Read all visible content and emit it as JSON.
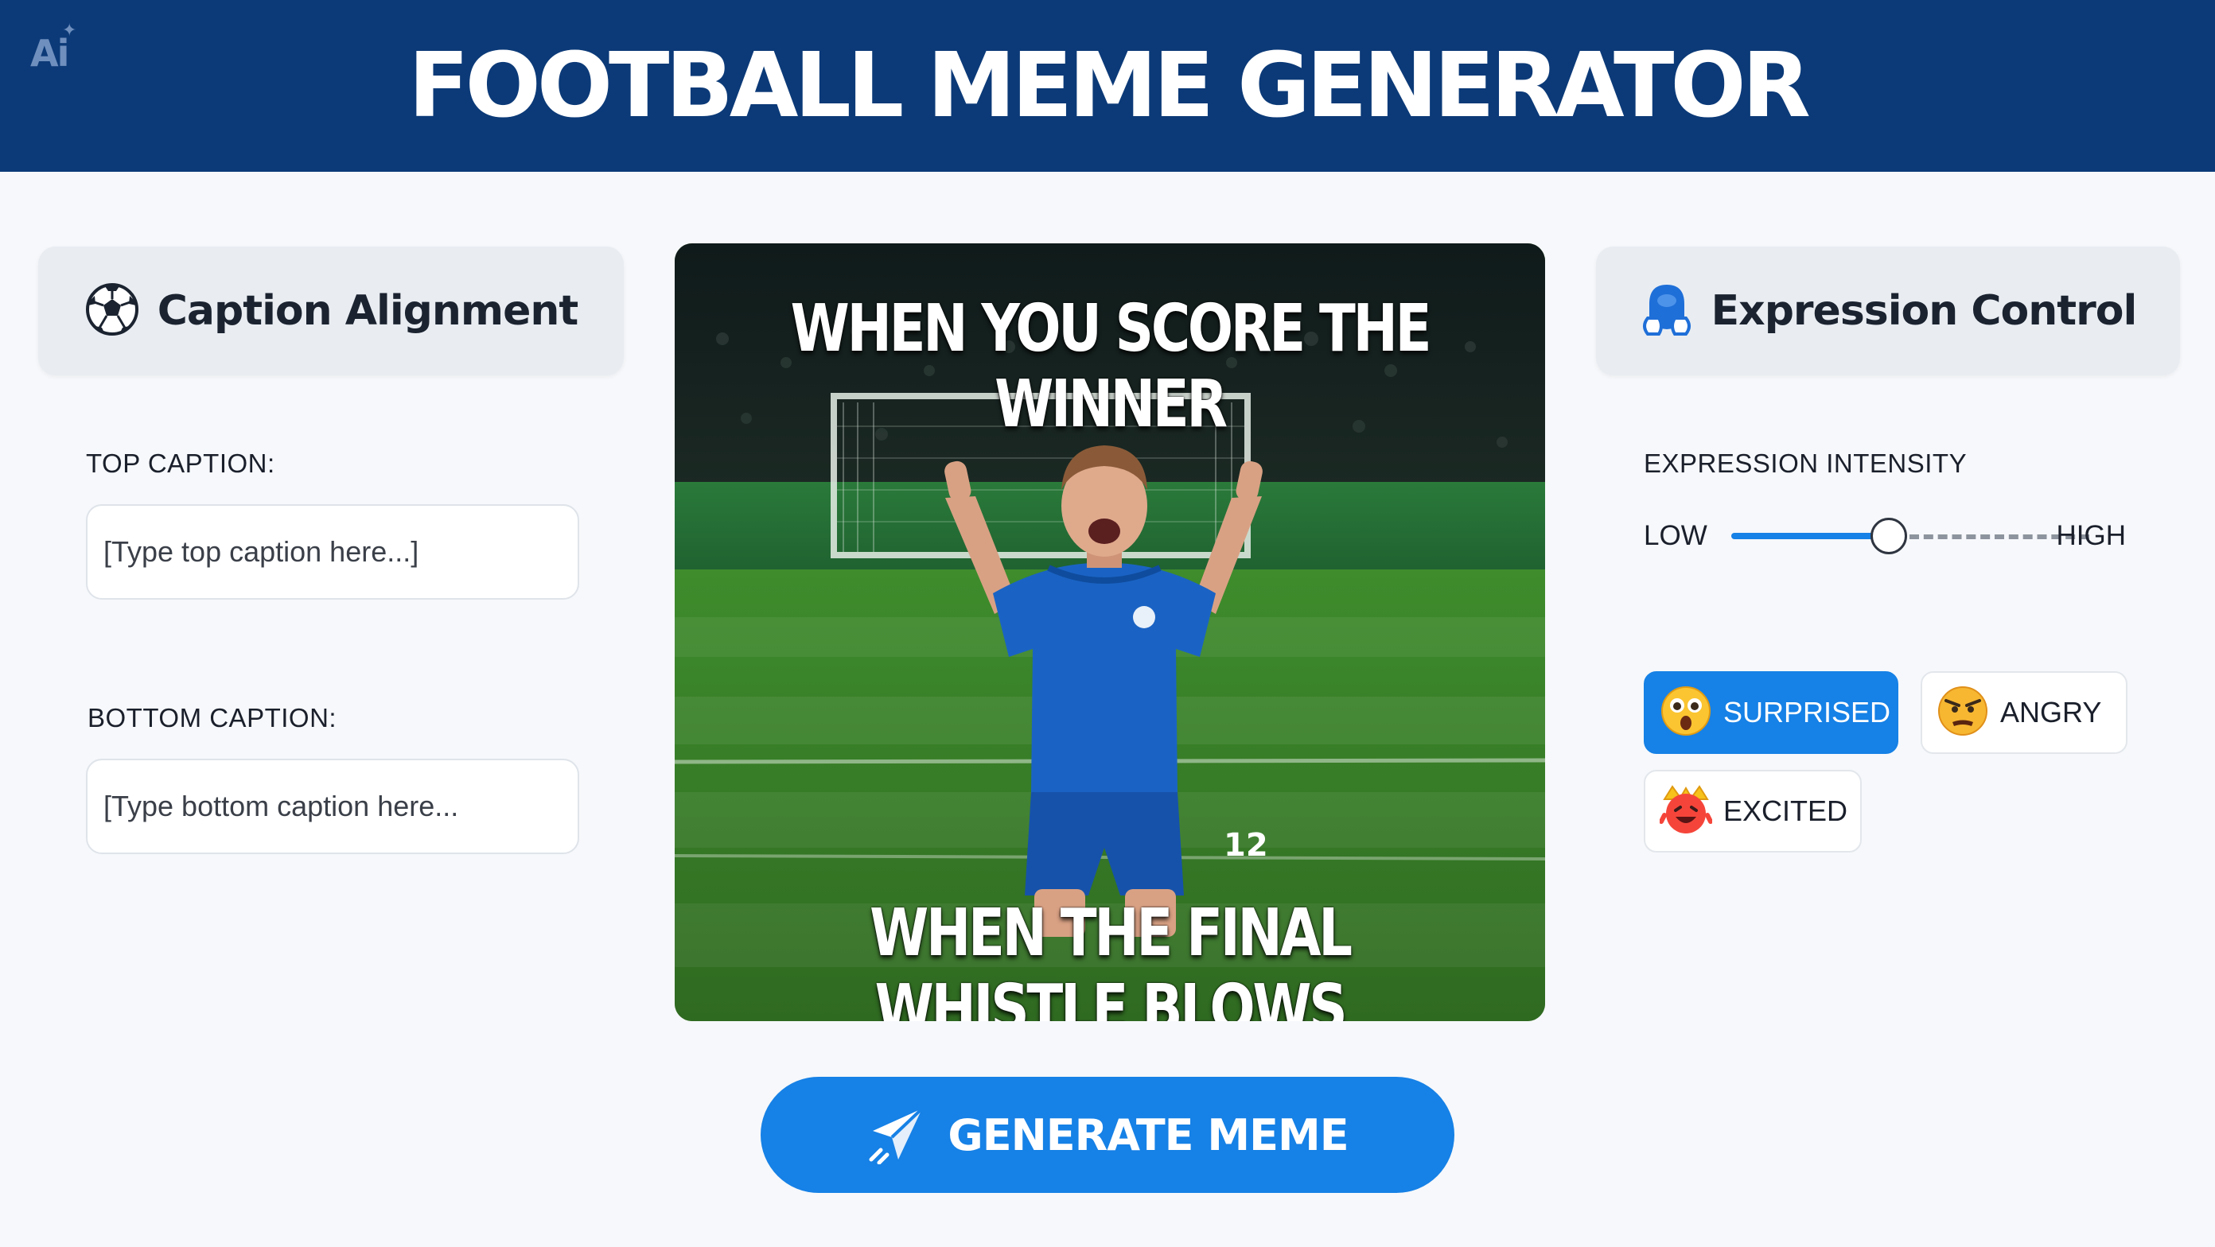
{
  "header": {
    "logo": "Ai",
    "title": "FOOTBALL MEME GENERATOR"
  },
  "left_panel": {
    "title": "Caption Alignment",
    "icon": "soccer-ball-icon",
    "top_caption": {
      "label": "TOP CAPTION:",
      "placeholder": "[Type top caption here...]"
    },
    "bottom_caption": {
      "label": "BOTTOM CAPTION:",
      "placeholder": "[Type bottom caption here..."
    }
  },
  "meme": {
    "top_text": "WHEN YOU SCORE THE WINNER",
    "bottom_text": "WHEN THE FINAL WHISTLE BLOWS",
    "player_number": "12"
  },
  "generate_button": {
    "label": "GENERATE MEME",
    "icon": "paper-plane-icon"
  },
  "right_panel": {
    "title": "Expression Control",
    "icon": "face-icon",
    "intensity": {
      "label": "EXPRESSION INTENSITY",
      "low_label": "LOW",
      "high_label": "HIGH",
      "value": 0.44
    },
    "expressions": [
      {
        "label": "SURPRISED",
        "icon": "surprised-face-icon",
        "selected": true
      },
      {
        "label": "ANGRY",
        "icon": "angry-face-icon",
        "selected": false
      },
      {
        "label": "EXCITED",
        "icon": "excited-face-icon",
        "selected": false
      }
    ]
  },
  "colors": {
    "header_bg": "#0c3a78",
    "accent": "#1681e6",
    "page_bg": "#f6f8fb"
  }
}
